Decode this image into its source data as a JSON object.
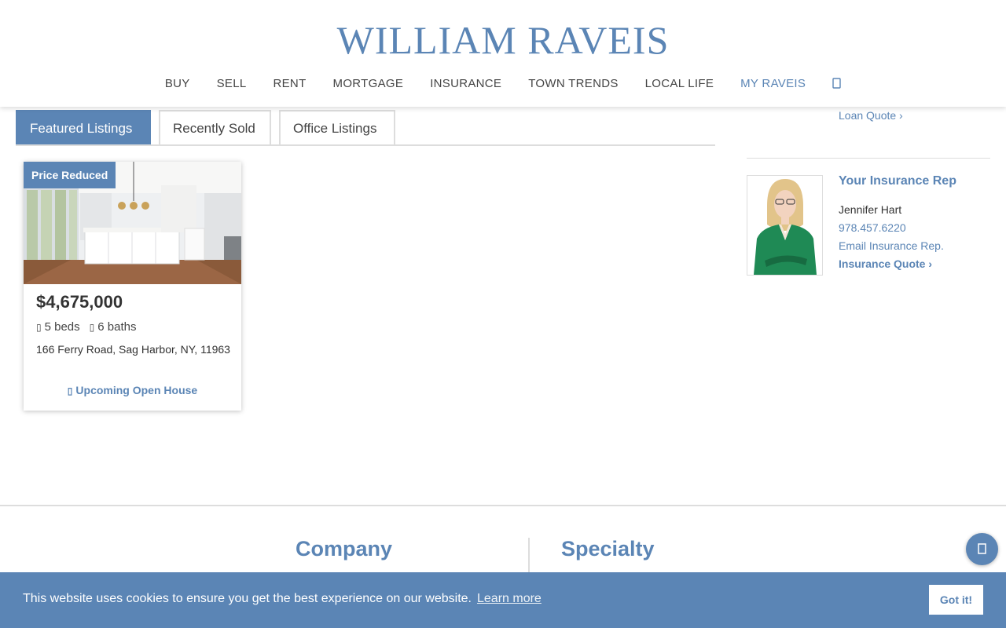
{
  "header": {
    "logo_text": "WILLIAM RAVEIS",
    "nav": [
      "BUY",
      "SELL",
      "RENT",
      "MORTGAGE",
      "INSURANCE",
      "TOWN TRENDS",
      "LOCAL LIFE",
      "MY RAVEIS"
    ],
    "user_icon": "user-icon"
  },
  "tabs": [
    "Featured Listings",
    "Recently Sold",
    "Office Listings"
  ],
  "listing": {
    "badge": "Price Reduced",
    "price": "$4,675,000",
    "beds": "5 beds",
    "baths": "6 baths",
    "bed_icon": "bed-icon",
    "bath_icon": "bath-icon",
    "address": "166 Ferry Road, Sag Harbor, NY, 11963",
    "open_house": "Upcoming Open House",
    "calendar_icon": "calendar-icon"
  },
  "sidebar": {
    "loan_quote": "Loan Quote ›",
    "rep_title": "Your Insurance Rep",
    "rep_name": "Jennifer Hart",
    "rep_phone": "978.457.6220",
    "rep_email": "Email Insurance Rep.",
    "rep_quote": "Insurance Quote ›"
  },
  "footer": {
    "col1": "Company",
    "col2": "Specialty"
  },
  "chat_icon": "chat-icon",
  "cookie": {
    "text": "This website uses cookies to ensure you get the best experience on our website.",
    "learn_more": "Learn more",
    "button": "Got it!"
  },
  "colors": {
    "accent": "#5b85b5"
  }
}
